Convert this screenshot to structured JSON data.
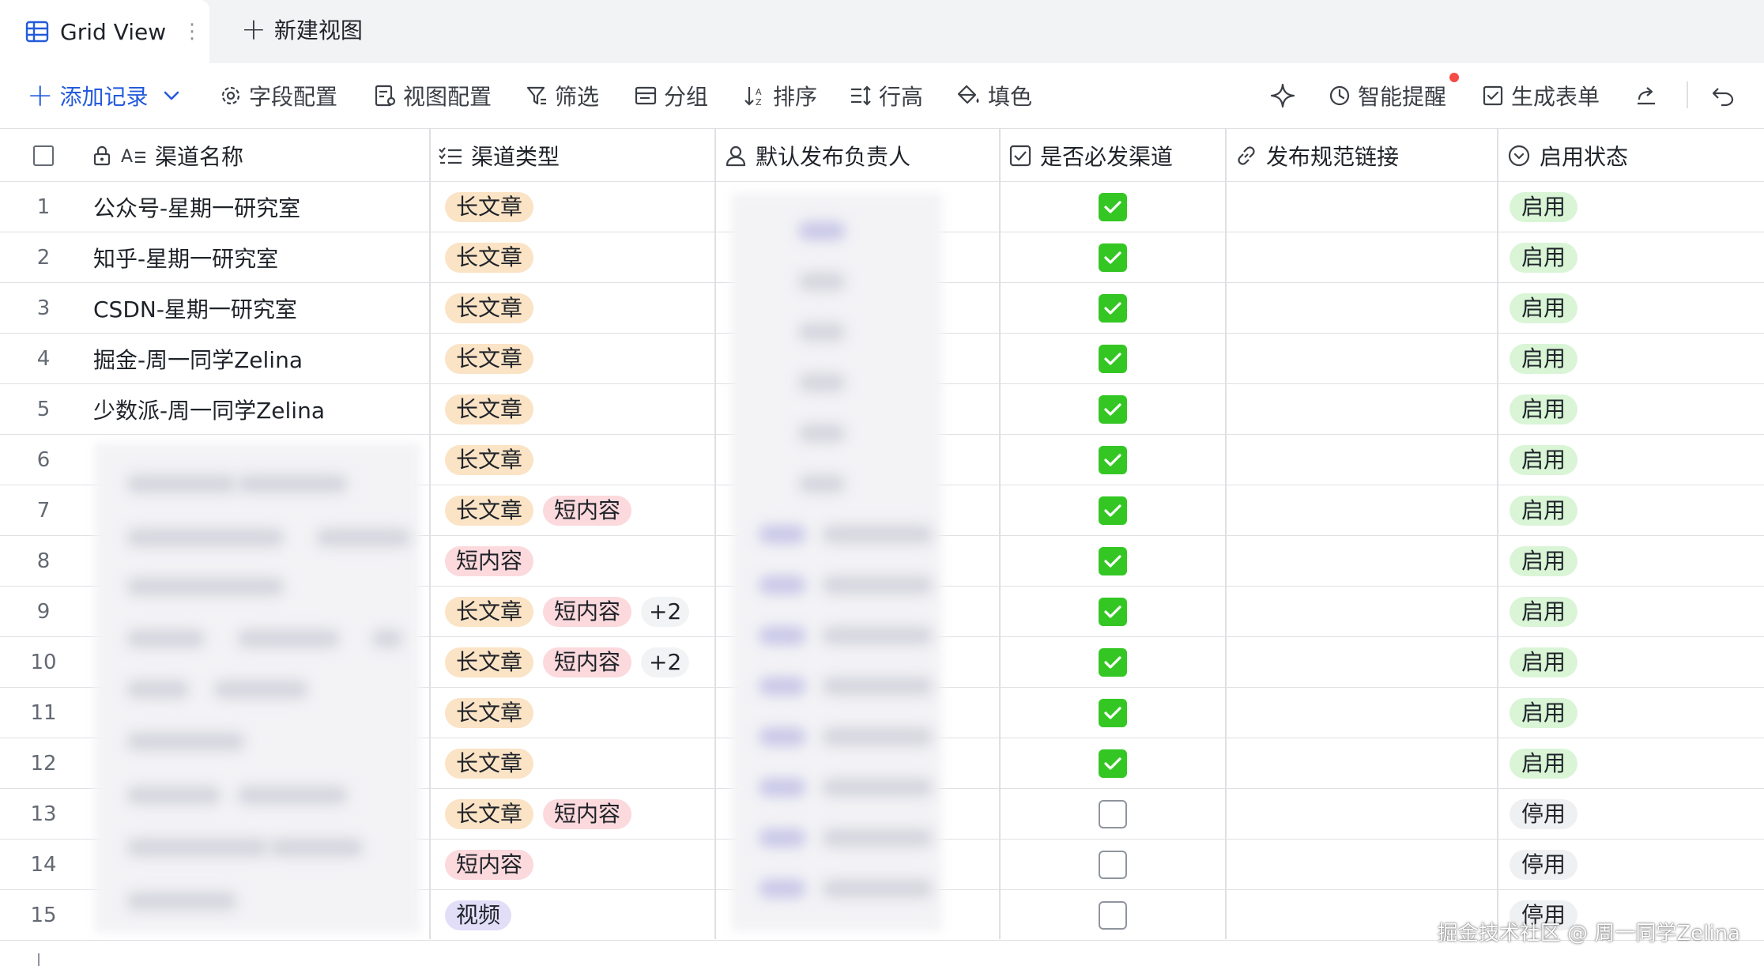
{
  "tabs": {
    "active_label": "Grid View",
    "new_label": "新建视图"
  },
  "toolbar": {
    "add_record": "添加记录",
    "field_config": "字段配置",
    "view_config": "视图配置",
    "filter": "筛选",
    "group": "分组",
    "sort": "排序",
    "row_height": "行高",
    "fill_color": "填色",
    "smart_reminder": "智能提醒",
    "generate_form": "生成表单"
  },
  "columns": {
    "channel_name": "渠道名称",
    "channel_type": "渠道类型",
    "default_owner": "默认发布负责人",
    "required_channel": "是否必发渠道",
    "spec_link": "发布规范链接",
    "enabled_status": "启用状态"
  },
  "rows": [
    {
      "num": "1",
      "name": "公众号-星期一研究室",
      "types": [
        "长文章"
      ],
      "more": "",
      "required": true,
      "status": "启用"
    },
    {
      "num": "2",
      "name": "知乎-星期一研究室",
      "types": [
        "长文章"
      ],
      "more": "",
      "required": true,
      "status": "启用"
    },
    {
      "num": "3",
      "name": "CSDN-星期一研究室",
      "types": [
        "长文章"
      ],
      "more": "",
      "required": true,
      "status": "启用"
    },
    {
      "num": "4",
      "name": "掘金-周一同学Zelina",
      "types": [
        "长文章"
      ],
      "more": "",
      "required": true,
      "status": "启用"
    },
    {
      "num": "5",
      "name": "少数派-周一同学Zelina",
      "types": [
        "长文章"
      ],
      "more": "",
      "required": true,
      "status": "启用"
    },
    {
      "num": "6",
      "name": "",
      "types": [
        "长文章"
      ],
      "more": "",
      "required": true,
      "status": "启用"
    },
    {
      "num": "7",
      "name": "",
      "types": [
        "长文章",
        "短内容"
      ],
      "more": "",
      "required": true,
      "status": "启用"
    },
    {
      "num": "8",
      "name": "",
      "types": [
        "短内容"
      ],
      "more": "",
      "required": true,
      "status": "启用"
    },
    {
      "num": "9",
      "name": "",
      "types": [
        "长文章",
        "短内容"
      ],
      "more": "+2",
      "required": true,
      "status": "启用"
    },
    {
      "num": "10",
      "name": "",
      "types": [
        "长文章",
        "短内容"
      ],
      "more": "+2",
      "required": true,
      "status": "启用"
    },
    {
      "num": "11",
      "name": "",
      "types": [
        "长文章"
      ],
      "more": "",
      "required": true,
      "status": "启用"
    },
    {
      "num": "12",
      "name": "",
      "types": [
        "长文章"
      ],
      "more": "",
      "required": true,
      "status": "启用"
    },
    {
      "num": "13",
      "name": "",
      "types": [
        "长文章",
        "短内容"
      ],
      "more": "",
      "required": false,
      "status": "停用"
    },
    {
      "num": "14",
      "name": "",
      "types": [
        "短内容"
      ],
      "more": "",
      "required": false,
      "status": "停用"
    },
    {
      "num": "15",
      "name": "",
      "types": [
        "视频"
      ],
      "more": "",
      "required": false,
      "status": "停用"
    }
  ],
  "tag_styles": {
    "长文章": "long",
    "短内容": "short",
    "视频": "video"
  },
  "colors": {
    "accent": "#245bdb",
    "checkbox_green": "#34c724",
    "tag_long": "#fbe3c5",
    "tag_short": "#fbd9dc",
    "tag_video": "#e2def8",
    "status_on": "#d9f5d6",
    "status_off": "#eff0f1"
  },
  "watermark": "掘金技术社区 @ 周一同学Zelina"
}
